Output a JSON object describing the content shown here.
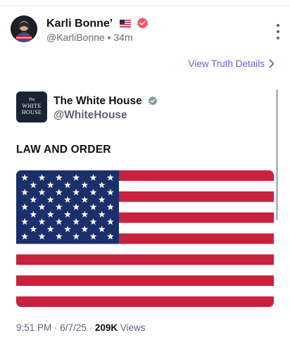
{
  "post": {
    "author_name": "Karli Bonne’",
    "author_flag": "🇺🇸",
    "author_handle": "@KarliBonne",
    "time_ago": "34m",
    "view_details_label": "View Truth Details"
  },
  "embed": {
    "logo_lines": [
      "The",
      "WHITE",
      "HOUSE"
    ],
    "name": "The White House",
    "handle": "@WhiteHouse",
    "text": "LAW AND ORDER",
    "time": "9:51 PM",
    "date": "6/7/25",
    "views_count": "209K",
    "views_label": "Views"
  },
  "colors": {
    "accent": "#6a5ad9",
    "verified_badge": "#ff4f5e",
    "flag_red": "#c8223d",
    "flag_blue": "#1b2f6b"
  }
}
